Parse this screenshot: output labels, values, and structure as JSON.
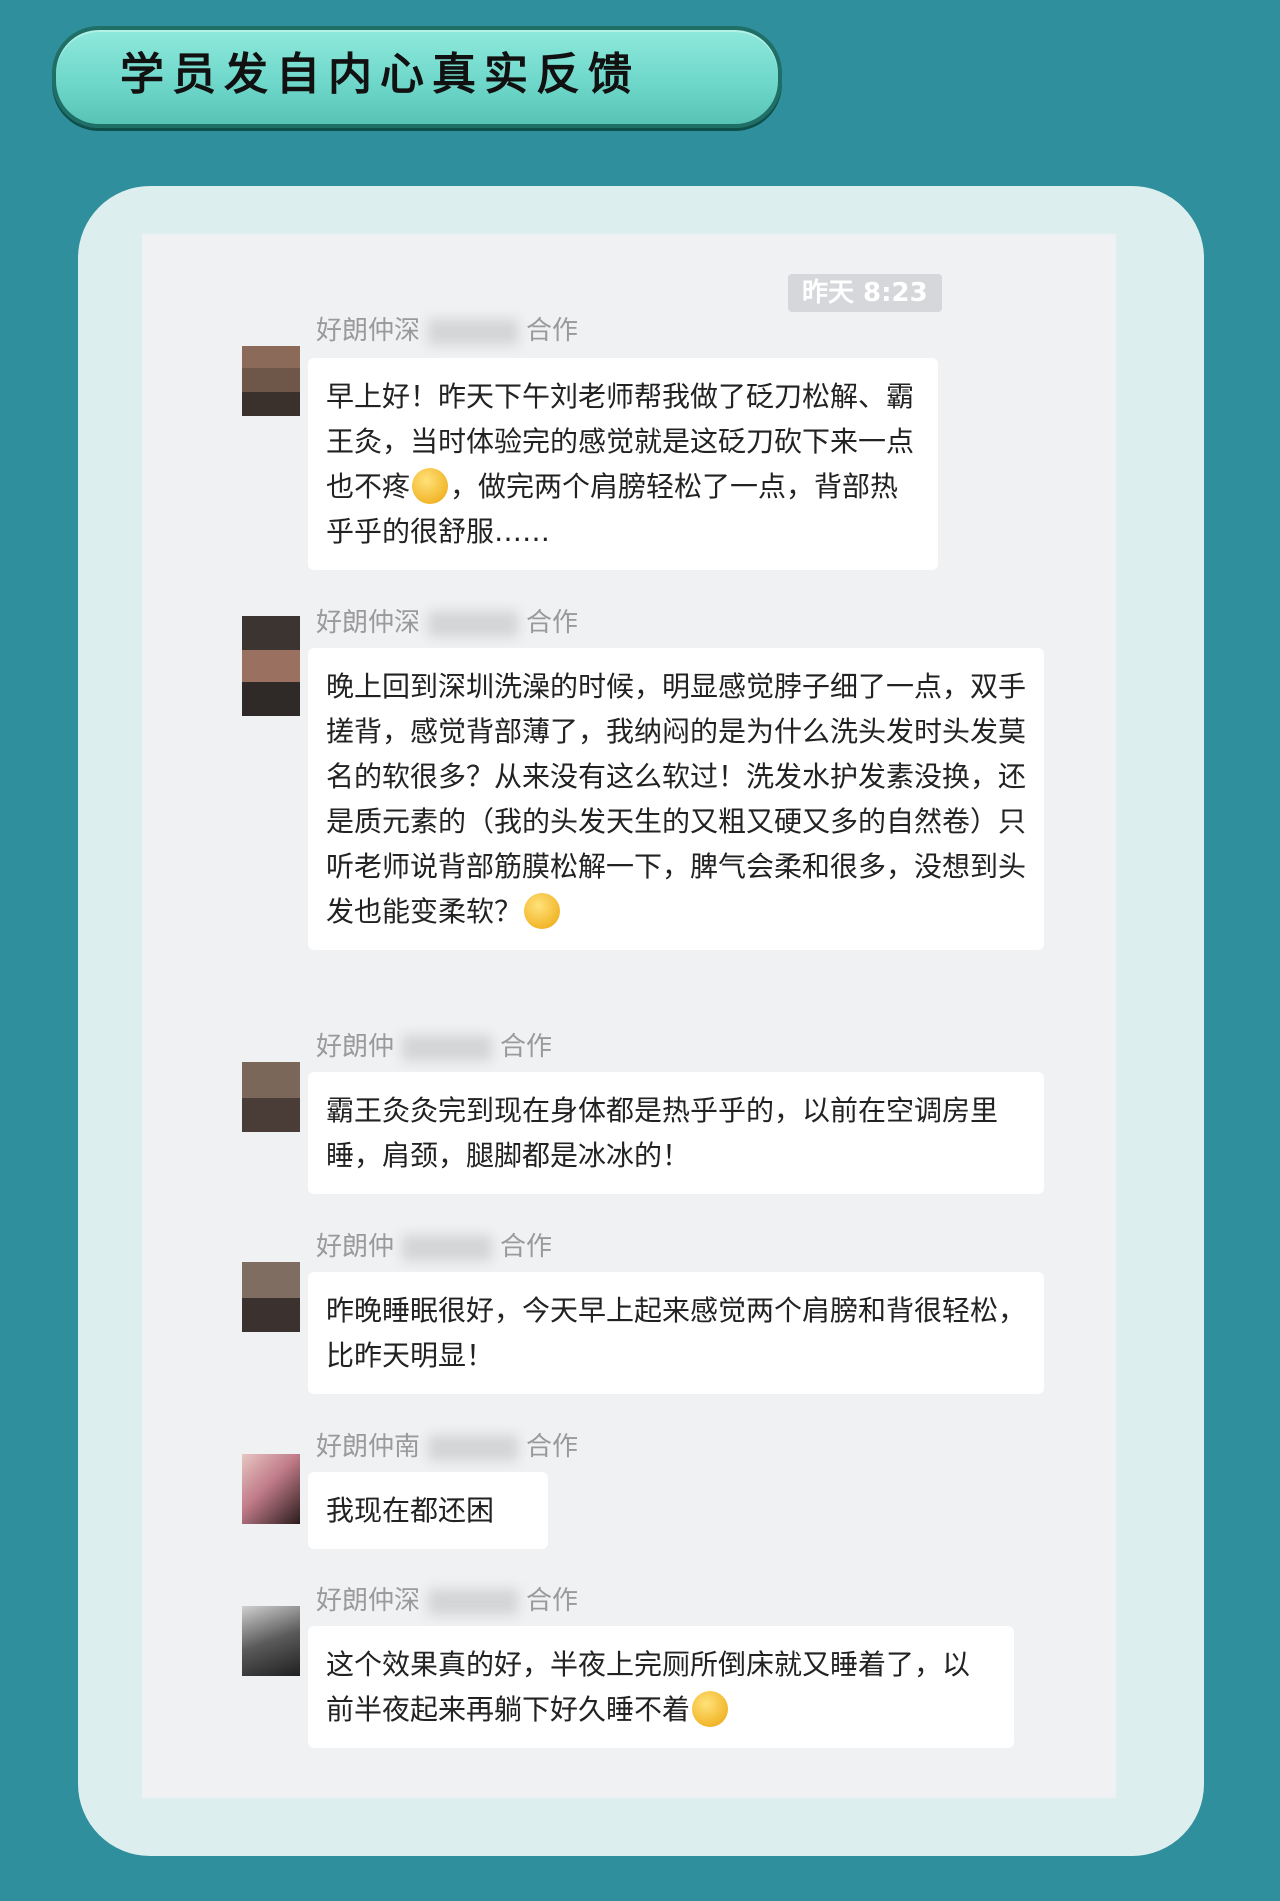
{
  "banner": {
    "title": "学员发自内心真实反馈"
  },
  "chat": {
    "timestamp": "昨天 8:23",
    "messages": [
      {
        "sender_prefix": "好朗仲深",
        "sender_suffix": "合作",
        "text_parts": [
          "早上好！昨天下午刘老师帮我做了砭刀松解、霸王灸，当时体验完的感觉就是这砭刀砍下来一点也不疼",
          "，做完两个肩膀轻松了一点，背部热乎乎的很舒服……"
        ],
        "emoji": "thinking-face-icon"
      },
      {
        "sender_prefix": "好朗仲深",
        "sender_suffix": "合作",
        "text_parts": [
          "晚上回到深圳洗澡的时候，明显感觉脖子细了一点，双手搓背，感觉背部薄了，我纳闷的是为什么洗头发时头发莫名的软很多？从来没有这么软过！洗发水护发素没换，还是质元素的（我的头发天生的又粗又硬又多的自然卷）只听老师说背部筋膜松解一下，脾气会柔和很多，没想到头发也能变柔软？",
          ""
        ],
        "emoji": "thinking-face-icon"
      },
      {
        "sender_prefix": "好朗仲",
        "sender_suffix": "合作",
        "text_parts": [
          "霸王灸灸完到现在身体都是热乎乎的，以前在空调房里睡，肩颈，腿脚都是冰冰的！"
        ]
      },
      {
        "sender_prefix": "好朗仲",
        "sender_suffix": "合作",
        "text_parts": [
          "昨晚睡眠很好，今天早上起来感觉两个肩膀和背很轻松，比昨天明显！"
        ]
      },
      {
        "sender_prefix": "好朗仲南",
        "sender_suffix": "合作",
        "text_parts": [
          "我现在都还困"
        ]
      },
      {
        "sender_prefix": "好朗仲深",
        "sender_suffix": "合作",
        "text_parts": [
          "这个效果真的好，半夜上完厕所倒床就又睡着了，以前半夜起来再躺下好久睡不着",
          ""
        ],
        "emoji": "thinking-face-icon"
      }
    ]
  }
}
